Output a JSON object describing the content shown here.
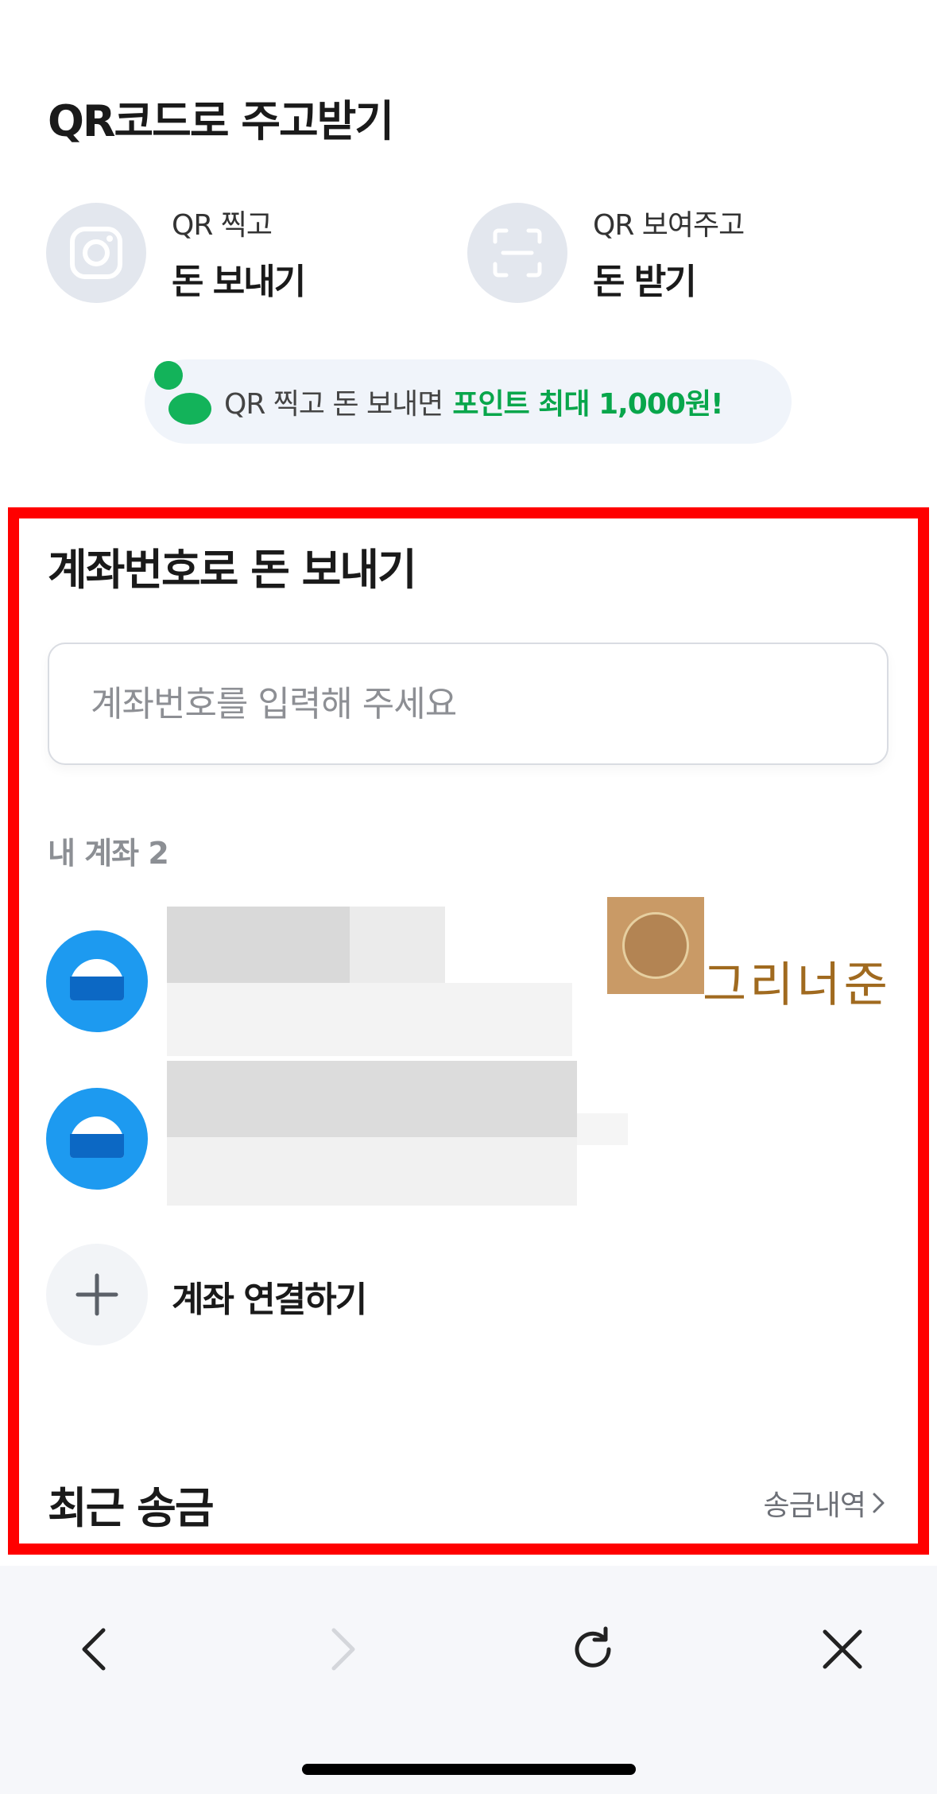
{
  "qr_section": {
    "title": "QR코드로 주고받기",
    "scan": {
      "sub": "QR 찍고",
      "main": "돈 보내기",
      "icon": "camera-icon"
    },
    "show": {
      "sub": "QR 보여주고",
      "main": "돈 받기",
      "icon": "qr-scan-frame-icon"
    },
    "promo": {
      "text": "QR 찍고 돈 보내면",
      "highlight": "포인트 최대 1,000원!",
      "highlight_color": "#08a64b"
    }
  },
  "account_transfer": {
    "title": "계좌번호로 돈 보내기",
    "input_placeholder": "계좌번호를 입력해 주세요",
    "my_accounts_label": "내 계좌 2",
    "accounts": [
      {
        "bank_icon": "bank-logo-icon"
      },
      {
        "bank_icon": "bank-logo-icon"
      }
    ],
    "add_account_label": "계좌 연결하기",
    "watermark_name": "그리너준"
  },
  "recent": {
    "title": "최근 송금",
    "history_link": "송금내역"
  },
  "browser_nav": {
    "back": "chevron-left-icon",
    "forward": "chevron-right-icon",
    "reload": "reload-icon",
    "close": "close-icon"
  },
  "colors": {
    "highlight_box": "#ff0000",
    "bank_blue": "#1d9af0",
    "promo_green": "#08a64b"
  }
}
